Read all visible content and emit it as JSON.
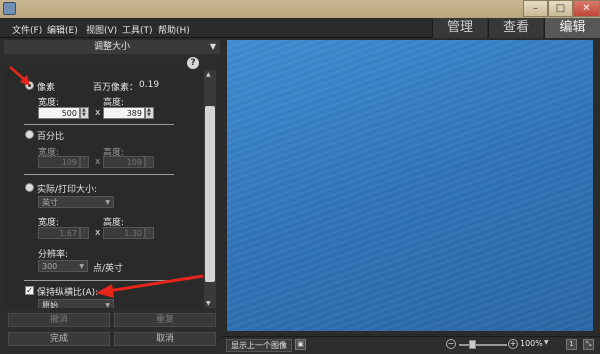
{
  "menu": [
    "文件(F)",
    "编辑(E)",
    "视图(V)",
    "工具(T)",
    "帮助(H)"
  ],
  "modes": [
    "管理",
    "查看",
    "编辑"
  ],
  "panel": {
    "title": "调整大小",
    "pixels": {
      "label": "像素",
      "megapixels_label": "百万像素：",
      "megapixels_value": "0.19",
      "width_label": "宽度:",
      "width_value": "500",
      "height_label": "高度:",
      "height_value": "389",
      "times": "x"
    },
    "percent": {
      "label": "百分比",
      "width_label": "宽度:",
      "width_value": "109",
      "height_label": "高度:",
      "height_value": "109",
      "times": "x"
    },
    "print": {
      "label": "实际/打印大小:",
      "unit": "英寸",
      "width_label": "宽度:",
      "width_value": "1.67",
      "height_label": "高度:",
      "height_value": "1.30",
      "times": "x",
      "resolution_label": "分辨率:",
      "resolution_value": "300",
      "resolution_unit": "点/英寸"
    },
    "keep_aspect": {
      "label": "保持纵横比(A):",
      "checked": true,
      "option": "原始"
    }
  },
  "buttons": {
    "undo": "撤消",
    "redo": "重复",
    "done": "完成",
    "cancel": "取消"
  },
  "bottom": {
    "prev_image": "显示上一个图像",
    "zoom": "100%"
  },
  "colors": {
    "annotation_arrow": "#e8251a",
    "image_blue": "#2f73b6"
  }
}
